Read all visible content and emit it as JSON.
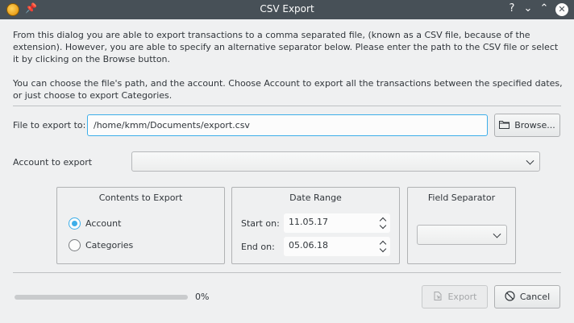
{
  "window": {
    "title": "CSV Export"
  },
  "intro": {
    "paragraph1": "From this dialog you are able to export transactions to a comma separated file, (known as a CSV file, because of the extension). However, you are able to specify an alternative separator below.  Please enter the path to the CSV file or select it by clicking on the Browse button.",
    "paragraph2": "You can choose the file's path, and the account. Choose Account to export all the transactions between the specified dates,  or just choose to export Categories."
  },
  "file": {
    "label": "File to export to:",
    "value": "/home/kmm/Documents/export.csv",
    "browse_label": "Browse..."
  },
  "account": {
    "label": "Account to export",
    "selected": ""
  },
  "contents": {
    "title": "Contents to Export",
    "options": [
      {
        "label": "Account",
        "checked": true
      },
      {
        "label": "Categories",
        "checked": false
      }
    ]
  },
  "date_range": {
    "title": "Date Range",
    "start_label": "Start on:",
    "start_value": "11.05.17",
    "end_label": "End on:",
    "end_value": "05.06.18"
  },
  "separator": {
    "title": "Field Separator",
    "selected": ""
  },
  "progress": {
    "percent": 0,
    "text": "0%"
  },
  "buttons": {
    "export_label": "Export",
    "cancel_label": "Cancel"
  },
  "colors": {
    "accent": "#3daee9",
    "titlebar": "#475057",
    "background": "#eff0f1"
  }
}
